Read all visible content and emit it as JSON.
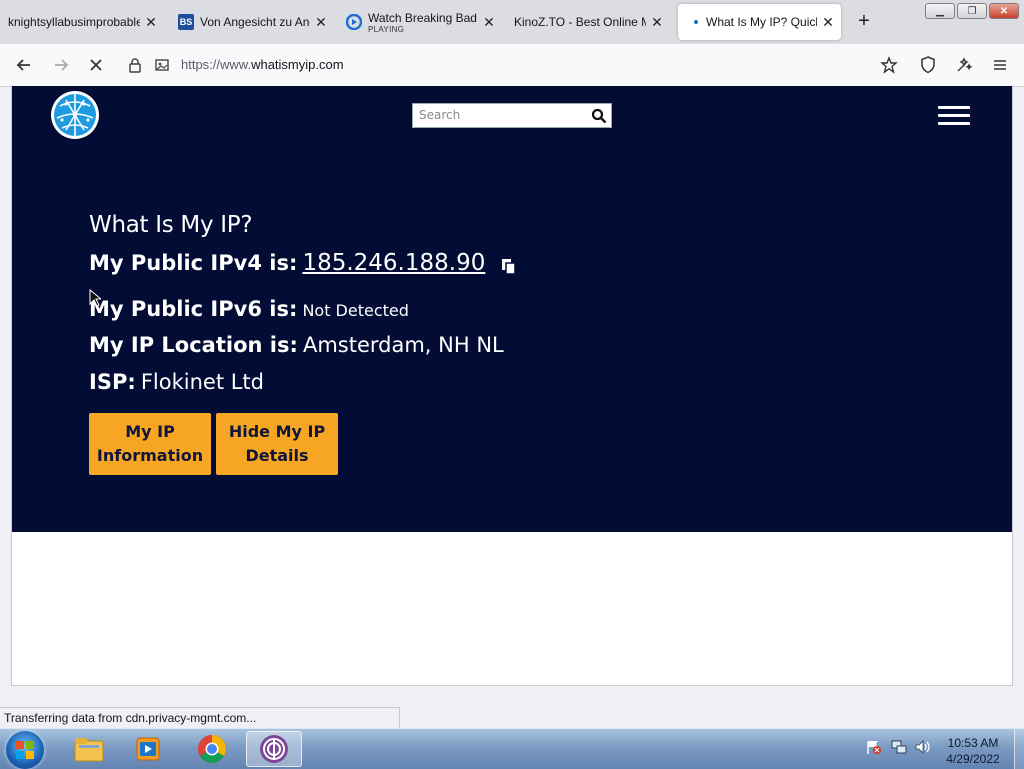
{
  "tabs": [
    {
      "title": "knightsyllabusimprobable",
      "icon": "page-icon"
    },
    {
      "title": "Von Angesicht zu Ang",
      "icon": "bs-icon"
    },
    {
      "title": "Watch Breaking Bad",
      "subtitle": "PLAYING",
      "icon": "play-icon"
    },
    {
      "title": "KinoZ.TO - Best Online M",
      "icon": "page-icon"
    },
    {
      "title": "What Is My IP? Quick",
      "icon": "loading-dot-icon"
    }
  ],
  "browser": {
    "url_prefix": "https://www.",
    "url_host": "whatismyip.com",
    "status_text": "Transferring data from cdn.privacy-mgmt.com..."
  },
  "site": {
    "search_placeholder": "Search",
    "heading": "What Is My IP?",
    "ipv4_label": "My Public IPv4 is:",
    "ipv4_value": "185.246.188.90",
    "ipv6_label": "My Public IPv6 is:",
    "ipv6_value": "Not Detected",
    "location_label": "My IP Location is:",
    "location_value": "Amsterdam, NH NL",
    "isp_label": "ISP:",
    "isp_value": "Flokinet Ltd",
    "button_info_line1": "My IP",
    "button_info_line2": "Information",
    "button_hide_line1": "Hide My IP",
    "button_hide_line2": "Details"
  },
  "taskbar": {
    "time": "10:53 AM",
    "date": "4/29/2022",
    "apps": [
      "explorer-icon",
      "media-player-icon",
      "chrome-icon",
      "tor-browser-icon"
    ]
  },
  "colors": {
    "hero_bg": "#020c35",
    "button_orange": "#f6a623",
    "tab_strip": "#dcdde3"
  }
}
